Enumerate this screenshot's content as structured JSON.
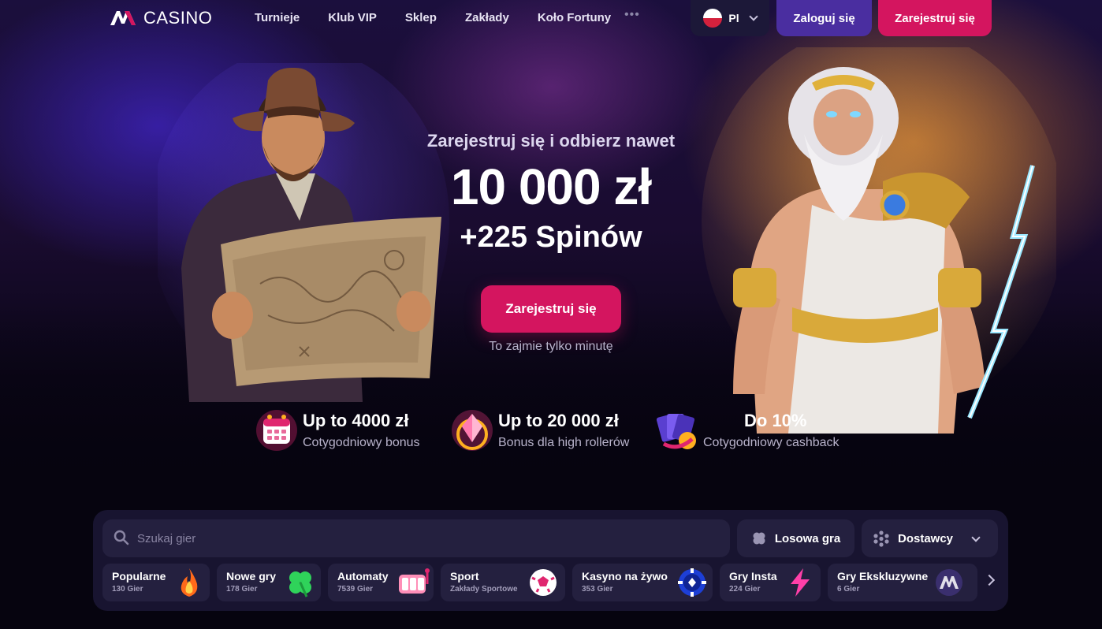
{
  "header": {
    "logo_text": "CASINO",
    "nav": [
      "Turnieje",
      "Klub VIP",
      "Sklep",
      "Zakłady",
      "Koło Fortuny"
    ],
    "more": "•••",
    "language": "Pl",
    "login_label": "Zaloguj się",
    "register_label": "Zarejestruj się"
  },
  "hero": {
    "subtitle": "Zarejestruj się i odbierz nawet",
    "amount": "10 000 zł",
    "spins": "+225 Spinów",
    "cta_label": "Zarejestruj się",
    "note": "To zajmie tylko minutę"
  },
  "perks": [
    {
      "title": "Up to 4000 zł",
      "desc": "Cotygodniowy bonus",
      "icon": "calendar-icon"
    },
    {
      "title": "Up to 20 000 zł",
      "desc": "Bonus dla high rollerów",
      "icon": "gem-icon"
    },
    {
      "title": "Do 10%",
      "desc": "Cotygodniowy cashback",
      "icon": "cards-icon"
    }
  ],
  "games": {
    "search_placeholder": "Szukaj gier",
    "random_label": "Losowa gra",
    "providers_label": "Dostawcy",
    "categories": [
      {
        "name": "Popularne",
        "count": "130 Gier",
        "icon": "fire-icon"
      },
      {
        "name": "Nowe gry",
        "count": "178 Gier",
        "icon": "clover-icon"
      },
      {
        "name": "Automaty",
        "count": "7539 Gier",
        "icon": "slot-machine-icon"
      },
      {
        "name": "Sport",
        "count": "Zakłady Sportowe",
        "icon": "soccer-ball-icon"
      },
      {
        "name": "Kasyno na żywo",
        "count": "353 Gier",
        "icon": "poker-chip-icon"
      },
      {
        "name": "Gry Insta",
        "count": "224 Gier",
        "icon": "lightning-icon"
      },
      {
        "name": "Gry Ekskluzywne",
        "count": "6 Gier",
        "icon": "brand-logo-icon"
      }
    ]
  },
  "colors": {
    "accent_pink": "#d4155f",
    "accent_purple": "#4a2ea0",
    "panel_bg": "#181430",
    "tile_bg": "#24203f"
  }
}
